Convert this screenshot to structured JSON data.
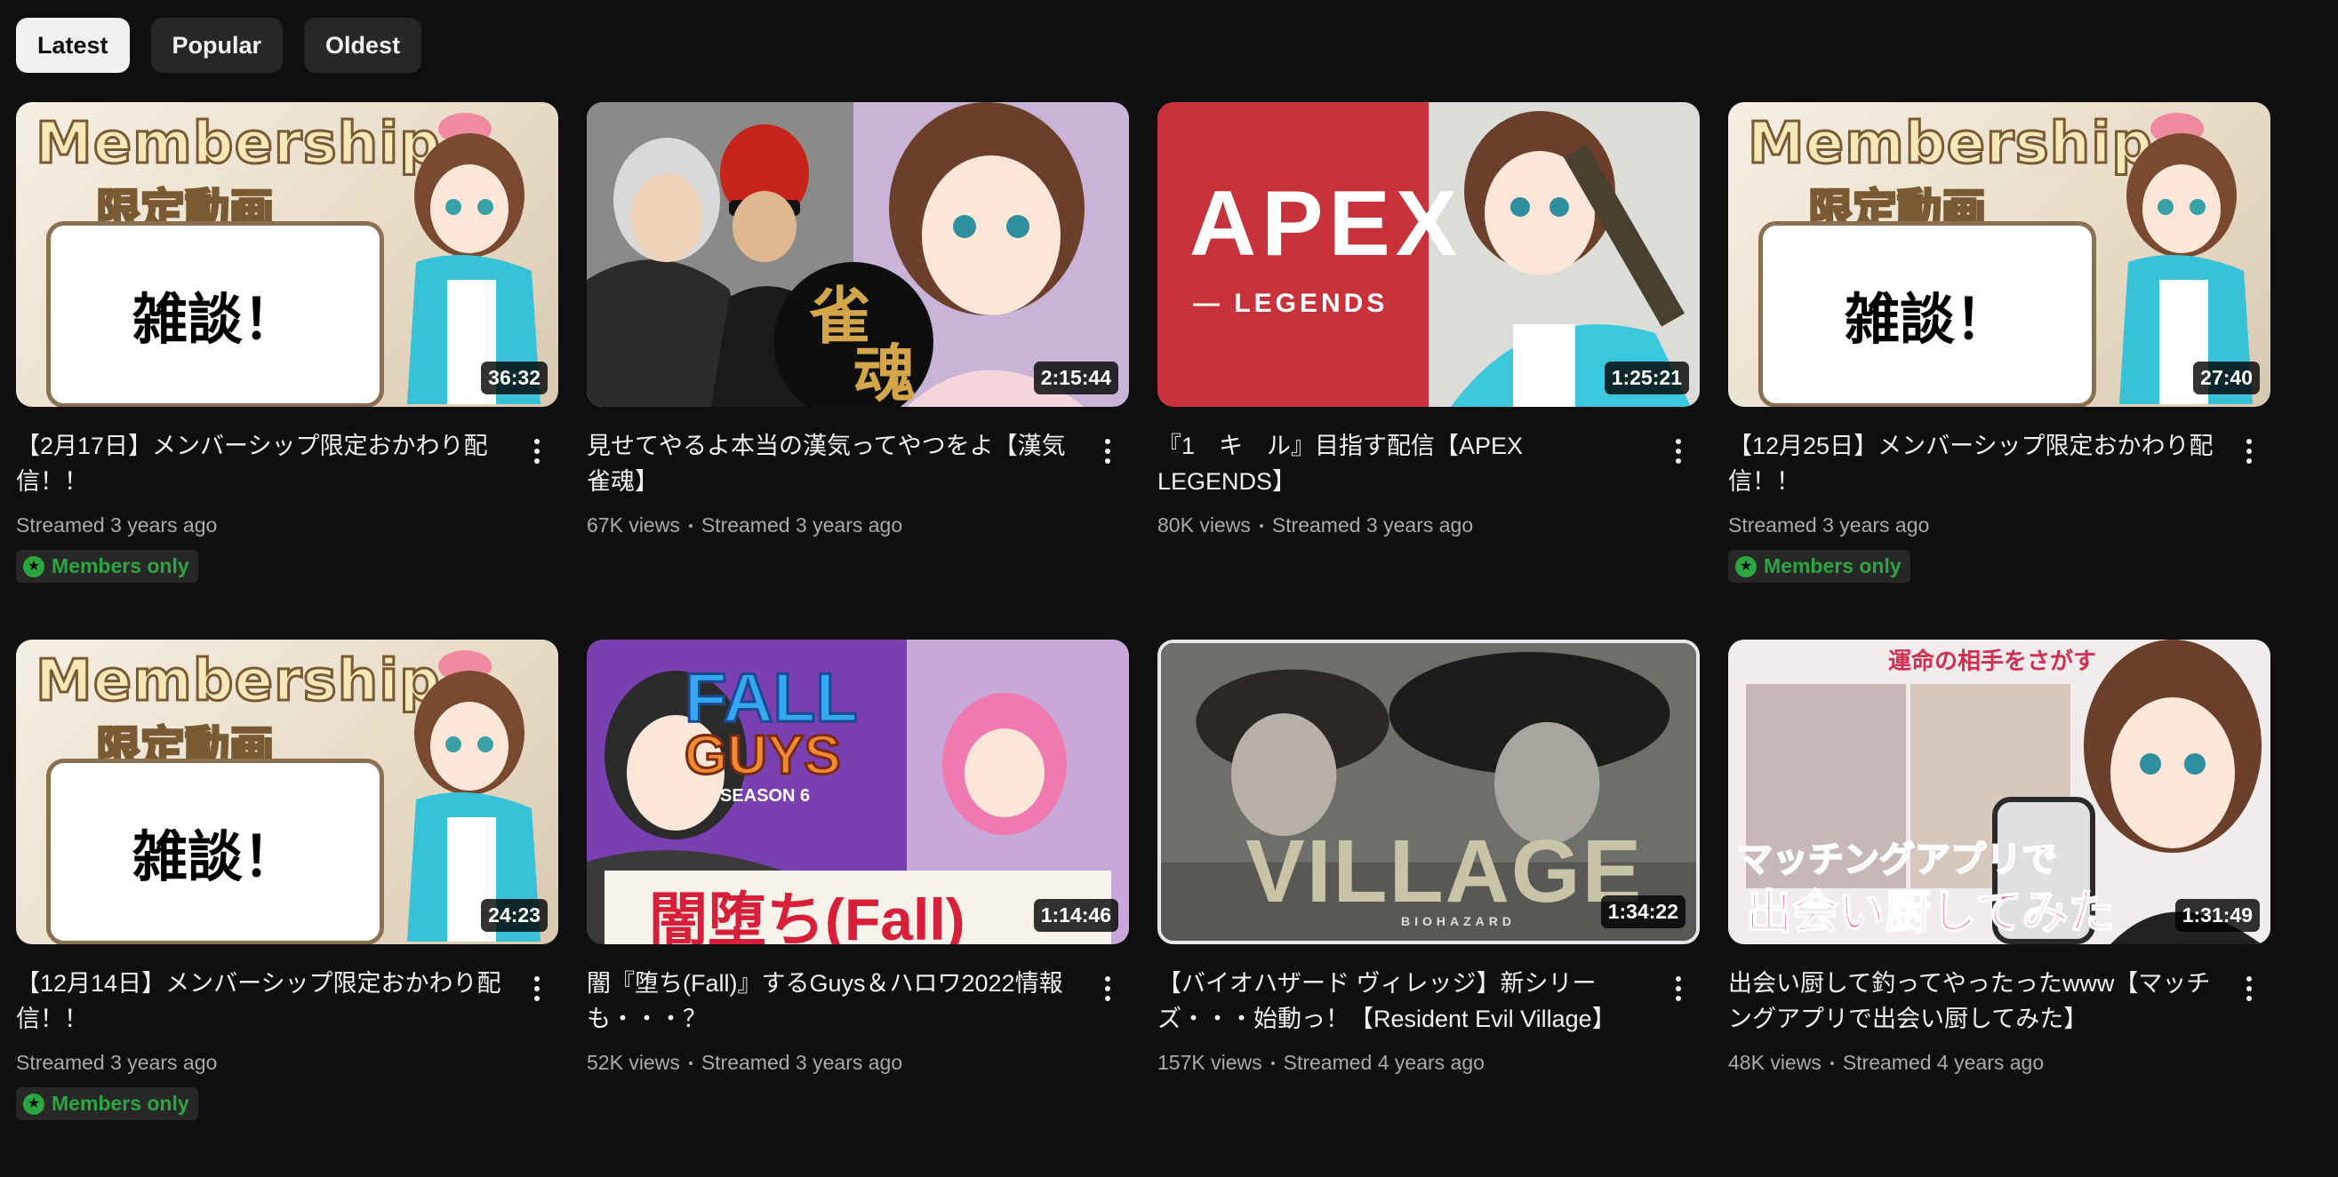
{
  "filters": [
    {
      "label": "Latest",
      "active": true
    },
    {
      "label": "Popular",
      "active": false
    },
    {
      "label": "Oldest",
      "active": false
    }
  ],
  "members_label": "Members only",
  "videos": [
    {
      "title": "【2月17日】メンバーシップ限定おかわり配信！！",
      "duration": "36:32",
      "views": "",
      "age": "Streamed 3 years ago",
      "members_only": true,
      "thumb_text": [
        "Membership",
        "限定動画",
        "雑談！"
      ]
    },
    {
      "title": "見せてやるよ本当の漢気ってやつをよ【漢気雀魂】",
      "duration": "2:15:44",
      "views": "67K views",
      "age": "Streamed 3 years ago",
      "members_only": false,
      "thumb_text": [
        "雀",
        "魂"
      ]
    },
    {
      "title": "『1　キ　ル』目指す配信【APEX LEGENDS】",
      "duration": "1:25:21",
      "views": "80K views",
      "age": "Streamed 3 years ago",
      "members_only": false,
      "thumb_text": [
        "APEX",
        "— LEGENDS"
      ]
    },
    {
      "title": "【12月25日】メンバーシップ限定おかわり配信！！",
      "duration": "27:40",
      "views": "",
      "age": "Streamed 3 years ago",
      "members_only": true,
      "thumb_text": [
        "Membership",
        "限定動画",
        "雑談！"
      ]
    },
    {
      "title": "【12月14日】メンバーシップ限定おかわり配信！！",
      "duration": "24:23",
      "views": "",
      "age": "Streamed 3 years ago",
      "members_only": true,
      "thumb_text": [
        "Membership",
        "限定動画",
        "雑談！"
      ]
    },
    {
      "title": "闇『堕ち(Fall)』するGuys＆ハロワ2022情報も・・・？",
      "duration": "1:14:46",
      "views": "52K views",
      "age": "Streamed 3 years ago",
      "members_only": false,
      "thumb_text": [
        "FALL",
        "GUYS",
        "SEASON 6",
        "闇堕ち(Fall)"
      ]
    },
    {
      "title": "【バイオハザード ヴィレッジ】新シリーズ・・・始動っ！【Resident Evil Village】",
      "duration": "1:34:22",
      "views": "157K views",
      "age": "Streamed 4 years ago",
      "members_only": false,
      "thumb_text": [
        "VILLAGE",
        "BIOHAZARD"
      ]
    },
    {
      "title": "出会い厨して釣ってやったったwww【マッチングアプリで出会い厨してみた】",
      "duration": "1:31:49",
      "views": "48K views",
      "age": "Streamed 4 years ago",
      "members_only": false,
      "thumb_text": [
        "運命の相手をさがす",
        "マッチングアプリで",
        "出会い厨してみた"
      ]
    }
  ]
}
